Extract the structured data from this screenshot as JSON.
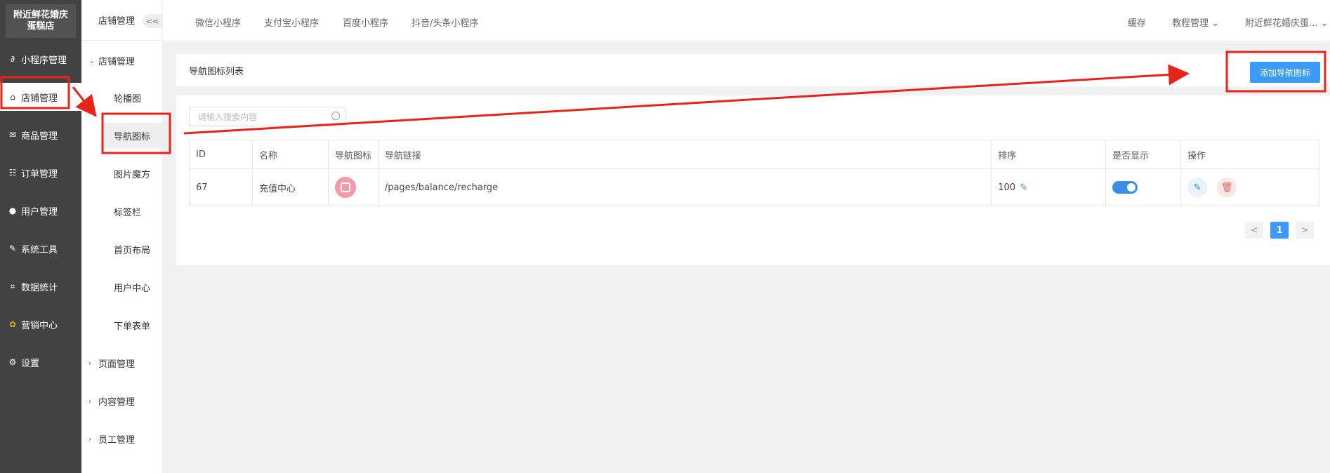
{
  "sidebar": {
    "logo_text": "附近鲜花婚庆蛋糕店",
    "items": [
      {
        "icon": "link-icon",
        "glyph": "∂",
        "label": "小程序管理"
      },
      {
        "icon": "store-icon",
        "glyph": "⌂",
        "label": "店铺管理"
      },
      {
        "icon": "mail-icon",
        "glyph": "✉",
        "label": "商品管理"
      },
      {
        "icon": "list-icon",
        "glyph": "☷",
        "label": "订单管理"
      },
      {
        "icon": "user-icon",
        "glyph": "●",
        "label": "用户管理"
      },
      {
        "icon": "wrench-icon",
        "glyph": "✎",
        "label": "系统工具"
      },
      {
        "icon": "chart-icon",
        "glyph": "⌗",
        "label": "数据统计"
      },
      {
        "icon": "marketing-icon",
        "glyph": "✿",
        "label": "营销中心"
      },
      {
        "icon": "gear-icon",
        "glyph": "⚙",
        "label": "设置"
      }
    ]
  },
  "subnav": {
    "header": "店铺管理",
    "collapse": "<<",
    "group_open": "店铺管理",
    "items": [
      "轮播图",
      "导航图标",
      "图片魔方",
      "标签栏",
      "首页布局",
      "用户中心",
      "下单表单"
    ],
    "groups_closed": [
      "页面管理",
      "内容管理",
      "员工管理"
    ]
  },
  "topbar": {
    "tabs": [
      "微信小程序",
      "支付宝小程序",
      "百度小程序",
      "抖音/头条小程序"
    ],
    "cache": "缓存",
    "tutorial": "教程管理",
    "store_name": "附近鲜花婚庆蛋..."
  },
  "panel": {
    "title": "导航图标列表",
    "add_button": "添加导航图标",
    "search_placeholder": "请输入搜索内容"
  },
  "table": {
    "headers": [
      "ID",
      "名称",
      "导航图标",
      "导航链接",
      "排序",
      "是否显示",
      "操作"
    ],
    "rows": [
      {
        "id": "67",
        "name": "充值中心",
        "link": "/pages/balance/recharge",
        "sort": "100",
        "visible": true
      }
    ]
  },
  "pagination": {
    "prev": "<",
    "current": "1",
    "next": ">"
  },
  "colors": {
    "accent": "#3a9bfa",
    "sidebar": "#424242",
    "annotation": "#e8231a"
  }
}
